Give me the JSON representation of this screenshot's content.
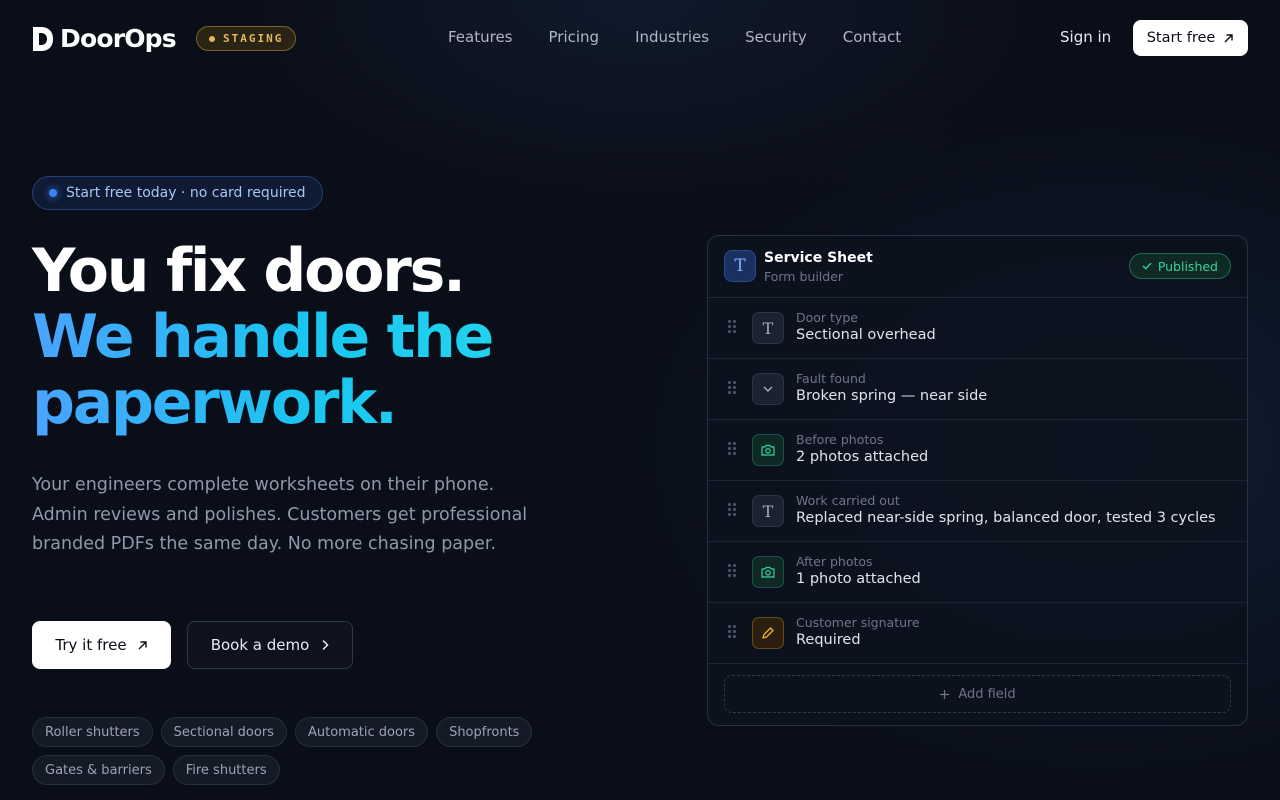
{
  "nav": {
    "brand": "DoorOps",
    "env_badge": "STAGING",
    "links": [
      "Features",
      "Pricing",
      "Industries",
      "Security",
      "Contact"
    ],
    "sign_in": "Sign in",
    "start_free": "Start free"
  },
  "hero": {
    "pill": "Start free today · no card required",
    "headline_line1": "You fix doors.",
    "headline_line2": "We handle the",
    "headline_line3": "paperwork.",
    "lede": "Your engineers complete worksheets on their phone. Admin reviews and polishes. Customers get professional branded PDFs the same day. No more chasing paper.",
    "cta_primary": "Try it free",
    "cta_secondary": "Book a demo",
    "tags": [
      "Roller shutters",
      "Sectional doors",
      "Automatic doors",
      "Shopfronts",
      "Gates & barriers",
      "Fire shutters"
    ]
  },
  "card": {
    "title": "Service Sheet",
    "subtitle": "Form builder",
    "status": "Published",
    "fields": [
      {
        "label": "Door type",
        "value": "Sectional overhead",
        "icon": "text-icon"
      },
      {
        "label": "Fault found",
        "value": "Broken spring — near side",
        "icon": "chevron-down-icon"
      },
      {
        "label": "Before photos",
        "value": "2 photos attached",
        "icon": "camera-icon"
      },
      {
        "label": "Work carried out",
        "value": "Replaced near-side spring, balanced door, tested 3 cycles",
        "icon": "text-icon"
      },
      {
        "label": "After photos",
        "value": "1 photo attached",
        "icon": "camera-icon"
      },
      {
        "label": "Customer signature",
        "value": "Required",
        "icon": "pen-icon"
      }
    ],
    "add_field": "Add field"
  },
  "colors": {
    "background": "#0a0e18",
    "accent_blue": "#4aa3ff",
    "accent_cyan": "#22d3ee",
    "staging": "#e2b85a",
    "success": "#34d399",
    "signature": "#f0b429"
  }
}
